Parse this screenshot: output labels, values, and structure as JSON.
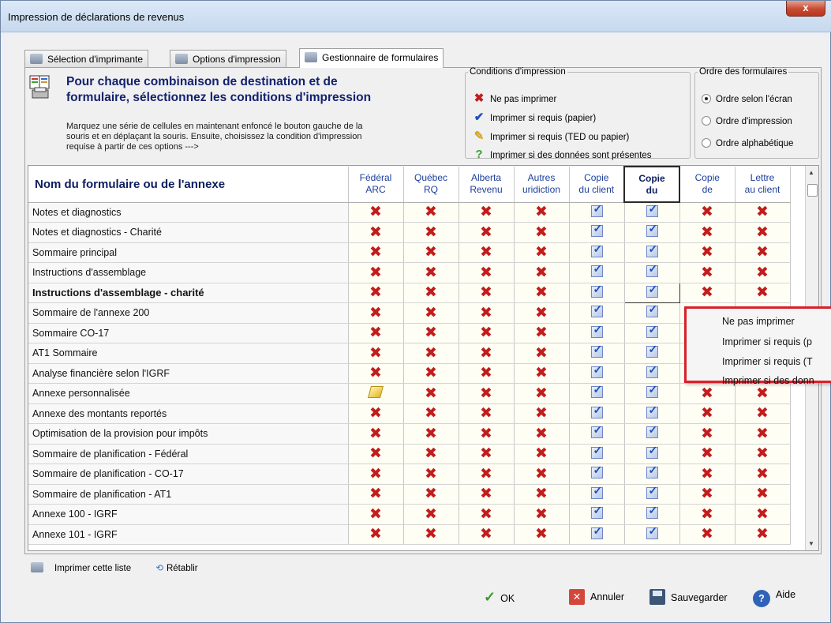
{
  "window": {
    "title": "Impression de déclarations de revenus",
    "close_label": "x"
  },
  "tabs": [
    {
      "label": "Sélection d'imprimante",
      "icon": "printer-icon"
    },
    {
      "label": "Options d'impression",
      "icon": "printer-options-icon"
    },
    {
      "label": "Gestionnaire de formulaires",
      "icon": "forms-manager-icon"
    }
  ],
  "heading": {
    "line1": "Pour chaque combinaison de destination et de",
    "line2": "formulaire, sélectionnez les conditions d'impression",
    "instructions_line1": "Marquez une série de cellules en maintenant enfoncé le bouton gauche de la",
    "instructions_line2": "souris et en déplaçant la souris.  Ensuite, choisissez la condition d'impression",
    "instructions_line3": "requise à partir de ces options --->"
  },
  "conditions": {
    "legend": "Conditions d'impression",
    "items": [
      {
        "label": "Ne pas imprimer",
        "icon": "red-x-icon"
      },
      {
        "label": "Imprimer si requis (papier)",
        "icon": "blue-check-icon"
      },
      {
        "label": "Imprimer si requis (TED ou papier)",
        "icon": "yellow-pencil-icon"
      },
      {
        "label": "Imprimer si des données sont présentes",
        "icon": "green-question-icon"
      }
    ]
  },
  "ordre": {
    "legend": "Ordre des formulaires",
    "options": [
      "Ordre selon l'écran",
      "Ordre d'impression",
      "Ordre alphabétique"
    ],
    "selected": "Ordre selon l'écran"
  },
  "table": {
    "name_header": "Nom du formulaire ou de l'annexe",
    "columns": [
      {
        "l1": "Fédéral",
        "l2": "ARC"
      },
      {
        "l1": "Québec",
        "l2": "RQ"
      },
      {
        "l1": "Alberta",
        "l2": "Revenu"
      },
      {
        "l1": "Autres",
        "l2": "uridiction"
      },
      {
        "l1": "Copie",
        "l2": "du client"
      },
      {
        "l1": "Copie",
        "l2": "du"
      },
      {
        "l1": "Copie",
        "l2": "de"
      },
      {
        "l1": "Lettre",
        "l2": "au client"
      }
    ],
    "rows": [
      "Notes et diagnostics",
      "Notes et diagnostics - Charité",
      "Sommaire principal",
      "Instructions d'assemblage",
      "Instructions d'assemblage - charité",
      "Sommaire de l'annexe 200",
      "Sommaire CO-17",
      "AT1 Sommaire",
      "Analyse financière selon l'IGRF",
      "Annexe personnalisée",
      "Annexe des montants reportés",
      "Optimisation de la provision pour impôts",
      "Sommaire de planification - Fédéral",
      "Sommaire de planification - CO-17",
      "Sommaire de planification - AT1",
      "Annexe 100 - IGRF",
      "Annexe 101 - IGRF"
    ]
  },
  "context_menu": {
    "items": [
      "Ne pas imprimer",
      "Imprimer si requis (p",
      "Imprimer si requis (T",
      "Imprimer si des donn"
    ]
  },
  "footer": {
    "print_list": "Imprimer cette liste",
    "reset": "Rétablir"
  },
  "buttons": {
    "ok": "OK",
    "cancel": "Annuler",
    "save": "Sauvegarder",
    "help": "Aide"
  }
}
